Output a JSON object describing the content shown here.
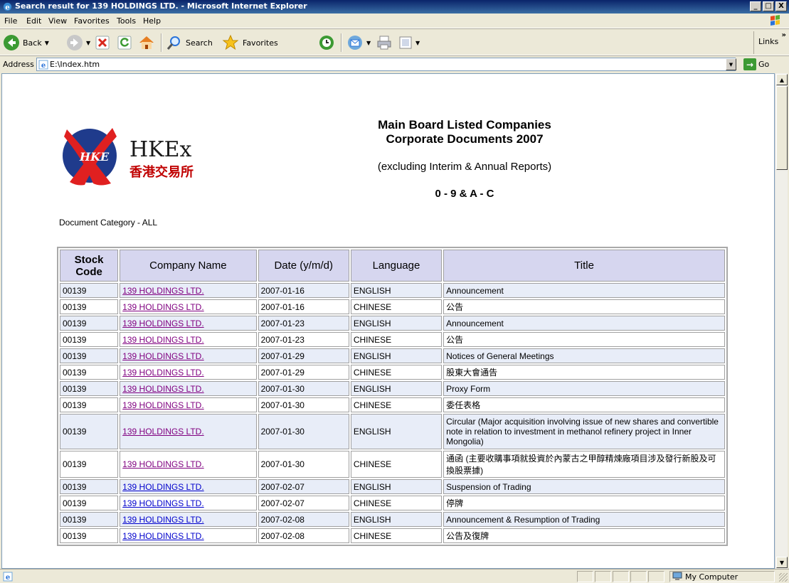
{
  "window": {
    "title": "Search result for 139 HOLDINGS LTD. - Microsoft Internet Explorer",
    "minimize": "_",
    "maximize": "□",
    "close": "X"
  },
  "menu": [
    "File",
    "Edit",
    "View",
    "Favorites",
    "Tools",
    "Help"
  ],
  "toolbar": {
    "back": "Back",
    "search": "Search",
    "favorites": "Favorites",
    "links": "Links"
  },
  "address": {
    "label": "Address",
    "value": "E:\\Index.htm",
    "go": "Go"
  },
  "page": {
    "logo_text_en": "HKEx",
    "logo_text_zh": "香港交易所",
    "logo_mark": "HKE",
    "heading_line1": "Main Board Listed Companies",
    "heading_line2": "Corporate Documents 2007",
    "subheading": "(excluding Interim & Annual Reports)",
    "range": "0 - 9 & A - C",
    "doc_category": "Document Category - ALL"
  },
  "table": {
    "headers": [
      "Stock Code",
      "Company Name",
      "Date (y/m/d)",
      "Language",
      "Title"
    ],
    "rows": [
      {
        "code": "00139",
        "company": "139 HOLDINGS LTD.",
        "date": "2007-01-16",
        "lang": "ENGLISH",
        "title": "Announcement"
      },
      {
        "code": "00139",
        "company": "139 HOLDINGS LTD.",
        "date": "2007-01-16",
        "lang": "CHINESE",
        "title": "公告"
      },
      {
        "code": "00139",
        "company": "139 HOLDINGS LTD.",
        "date": "2007-01-23",
        "lang": "ENGLISH",
        "title": "Announcement"
      },
      {
        "code": "00139",
        "company": "139 HOLDINGS LTD.",
        "date": "2007-01-23",
        "lang": "CHINESE",
        "title": "公告"
      },
      {
        "code": "00139",
        "company": "139 HOLDINGS LTD.",
        "date": "2007-01-29",
        "lang": "ENGLISH",
        "title": "Notices of General Meetings"
      },
      {
        "code": "00139",
        "company": "139 HOLDINGS LTD.",
        "date": "2007-01-29",
        "lang": "CHINESE",
        "title": "股東大會通告"
      },
      {
        "code": "00139",
        "company": "139 HOLDINGS LTD.",
        "date": "2007-01-30",
        "lang": "ENGLISH",
        "title": "Proxy Form"
      },
      {
        "code": "00139",
        "company": "139 HOLDINGS LTD.",
        "date": "2007-01-30",
        "lang": "CHINESE",
        "title": "委任表格"
      },
      {
        "code": "00139",
        "company": "139 HOLDINGS LTD.",
        "date": "2007-01-30",
        "lang": "ENGLISH",
        "title": "Circular (Major acquisition involving issue of new shares and convertible note in relation to investment in methanol refinery project in Inner Mongolia)"
      },
      {
        "code": "00139",
        "company": "139 HOLDINGS LTD.",
        "date": "2007-01-30",
        "lang": "CHINESE",
        "title": "通函 (主要收購事項就投資於內蒙古之甲醇精煉廠項目涉及發行新股及可換股票據)"
      },
      {
        "code": "00139",
        "company": "139 HOLDINGS LTD.",
        "date": "2007-02-07",
        "lang": "ENGLISH",
        "title": "Suspension of Trading"
      },
      {
        "code": "00139",
        "company": "139 HOLDINGS LTD.",
        "date": "2007-02-07",
        "lang": "CHINESE",
        "title": "停牌"
      },
      {
        "code": "00139",
        "company": "139 HOLDINGS LTD.",
        "date": "2007-02-08",
        "lang": "ENGLISH",
        "title": "Announcement & Resumption of Trading"
      },
      {
        "code": "00139",
        "company": "139 HOLDINGS LTD.",
        "date": "2007-02-08",
        "lang": "CHINESE",
        "title": "公告及復牌"
      }
    ]
  },
  "status": {
    "zone": "My Computer"
  },
  "colors": {
    "titlebar": "#0A246A",
    "header_bg": "#D6D6EF",
    "row_alt": "#E8EDF8",
    "link": "#800080"
  }
}
